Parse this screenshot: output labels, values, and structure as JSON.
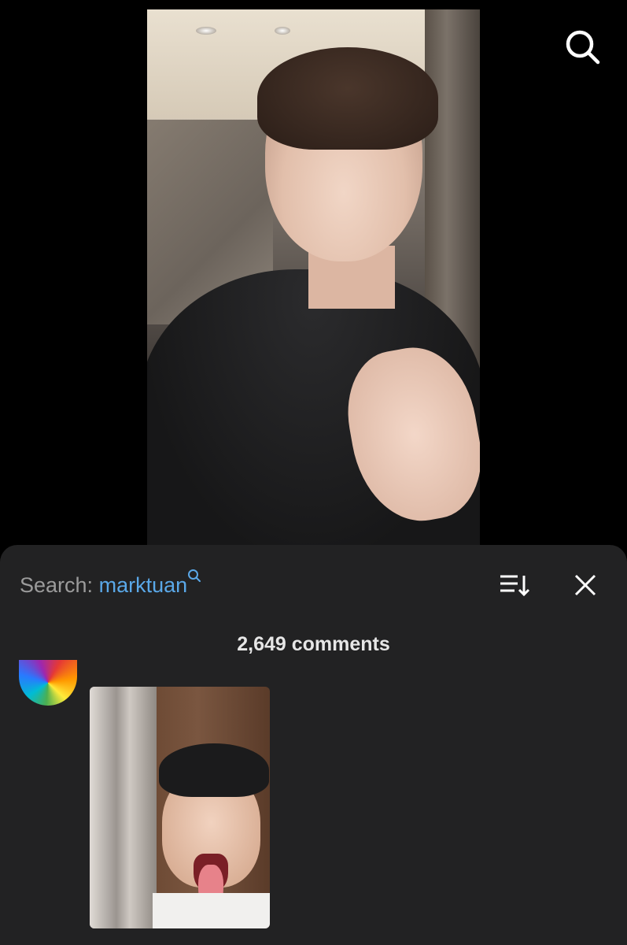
{
  "header": {
    "search_icon": "search-icon"
  },
  "comments_panel": {
    "search_prefix": "Search:",
    "search_term": "marktuan",
    "search_term_icon": "search-icon",
    "sort_icon": "sort-icon",
    "close_icon": "close-icon",
    "count_text": "2,649 comments"
  },
  "colors": {
    "accent": "#5aa8e8",
    "panel_bg": "#222223",
    "label_gray": "#9b9b9b"
  }
}
